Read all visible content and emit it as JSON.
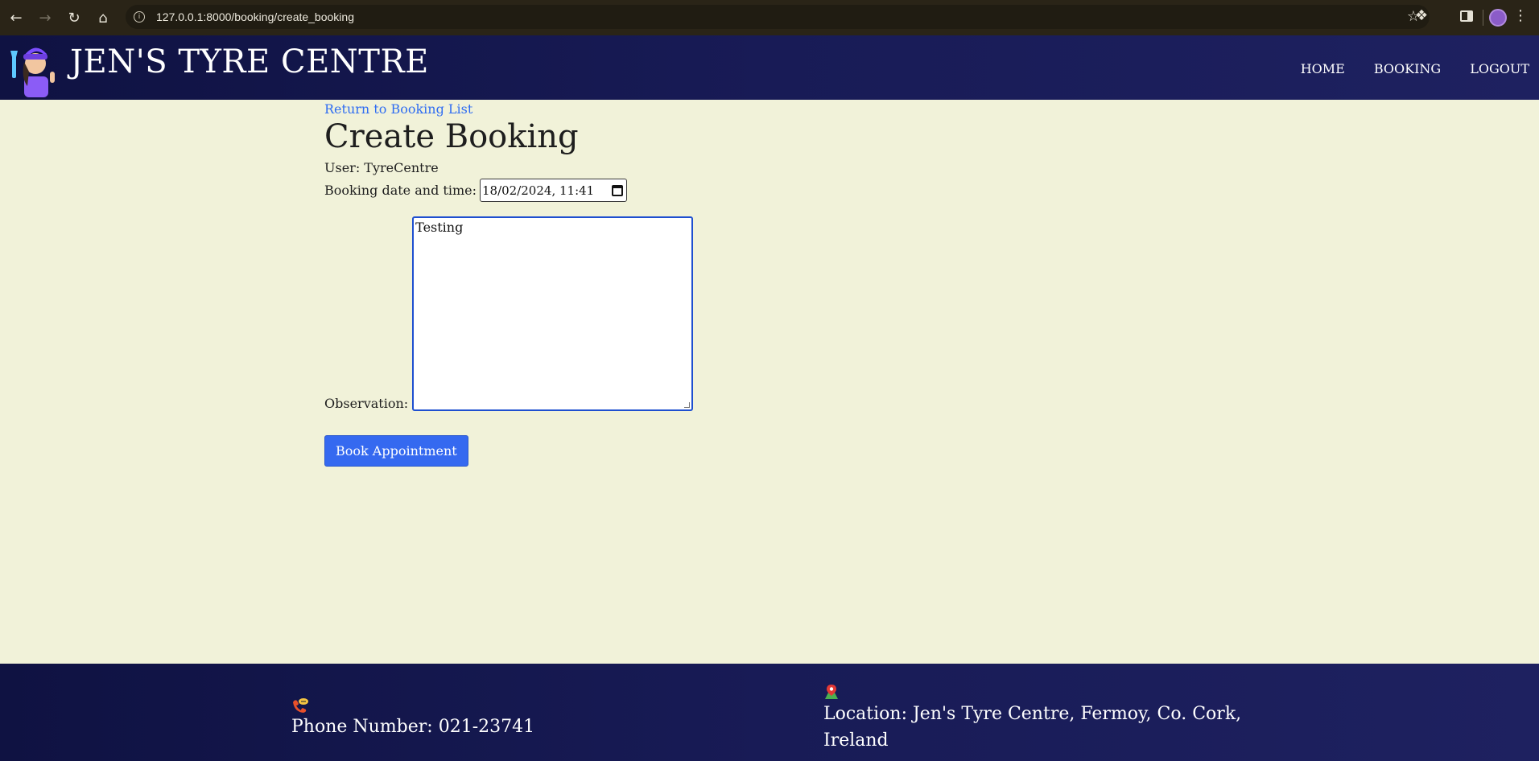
{
  "browser": {
    "url": "127.0.0.1:8000/booking/create_booking"
  },
  "header": {
    "brand": "JEN'S TYRE CENTRE",
    "nav": {
      "home": "HOME",
      "booking": "BOOKING",
      "logout": "LOGOUT"
    }
  },
  "main": {
    "return_link": "Return to Booking List",
    "title": "Create Booking",
    "user_line": "User: TyreCentre",
    "booking_datetime_label": "Booking date and time:",
    "booking_datetime_value": "18/02/2024, 11:41",
    "observation_label": "Observation:",
    "observation_value": "Testing",
    "submit_label": "Book Appointment"
  },
  "footer": {
    "phone": "Phone Number: 021-23741",
    "location": "Location: Jen's Tyre Centre, Fermoy, Co. Cork, Ireland"
  },
  "colors": {
    "header_bg": "#181b56",
    "page_bg": "#f1f2d9",
    "link": "#2e6cf2",
    "button": "#3569f0",
    "browser_chrome": "#2a2417"
  }
}
